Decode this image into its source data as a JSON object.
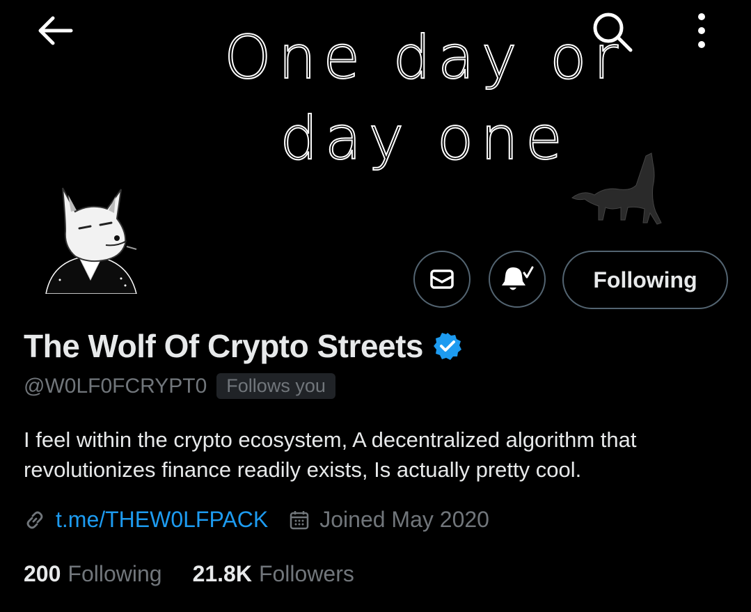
{
  "banner": {
    "line1": "One day or",
    "line2": "day one"
  },
  "nav": {
    "back_icon": "arrow-left-icon",
    "search_icon": "search-icon",
    "more_icon": "more-vertical-icon"
  },
  "actions": {
    "message_icon": "envelope-icon",
    "notifications_icon": "bell-check-icon",
    "following_label": "Following"
  },
  "profile": {
    "display_name": "The Wolf Of Crypto Streets",
    "verified": true,
    "handle": "@W0LF0FCRYPT0",
    "follows_you": "Follows you",
    "bio": "I feel within the crypto ecosystem, A decentralized algorithm that revolutionizes finance readily exists, Is actually pretty cool.",
    "link": "t.me/THEW0LFPACK",
    "joined": "Joined May 2020"
  },
  "stats": {
    "following_count": "200",
    "following_label": "Following",
    "followers_count": "21.8K",
    "followers_label": "Followers"
  },
  "colors": {
    "background": "#000000",
    "link": "#1d9bf0",
    "verified": "#1d9bf0",
    "muted": "#71767b",
    "border": "#536471"
  }
}
